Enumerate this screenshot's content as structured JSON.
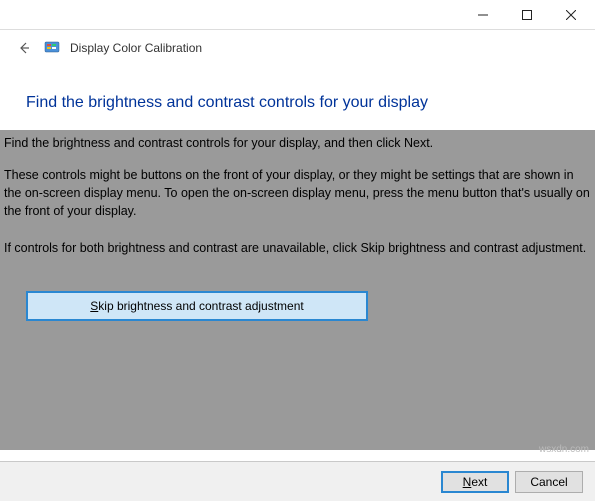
{
  "titlebar": {
    "minimize": "minimize",
    "maximize": "maximize",
    "close": "close"
  },
  "header": {
    "app_title": "Display Color Calibration"
  },
  "main": {
    "heading": "Find the brightness and contrast controls for your display",
    "paragraph1": "Find the brightness and contrast controls for your display, and then click Next.",
    "paragraph2": "These controls might be buttons on the front of your display, or they might be settings that are shown in the on-screen display menu. To open the on-screen display menu, press the menu button that's usually on the front of your display.",
    "paragraph3": "If controls for both brightness and contrast are unavailable, click Skip brightness and contrast adjustment.",
    "skip_button_prefix": "S",
    "skip_button_rest": "kip brightness and contrast adjustment"
  },
  "footer": {
    "next_prefix": "N",
    "next_rest": "ext",
    "cancel": "Cancel"
  },
  "watermark": "wsxdn.com"
}
